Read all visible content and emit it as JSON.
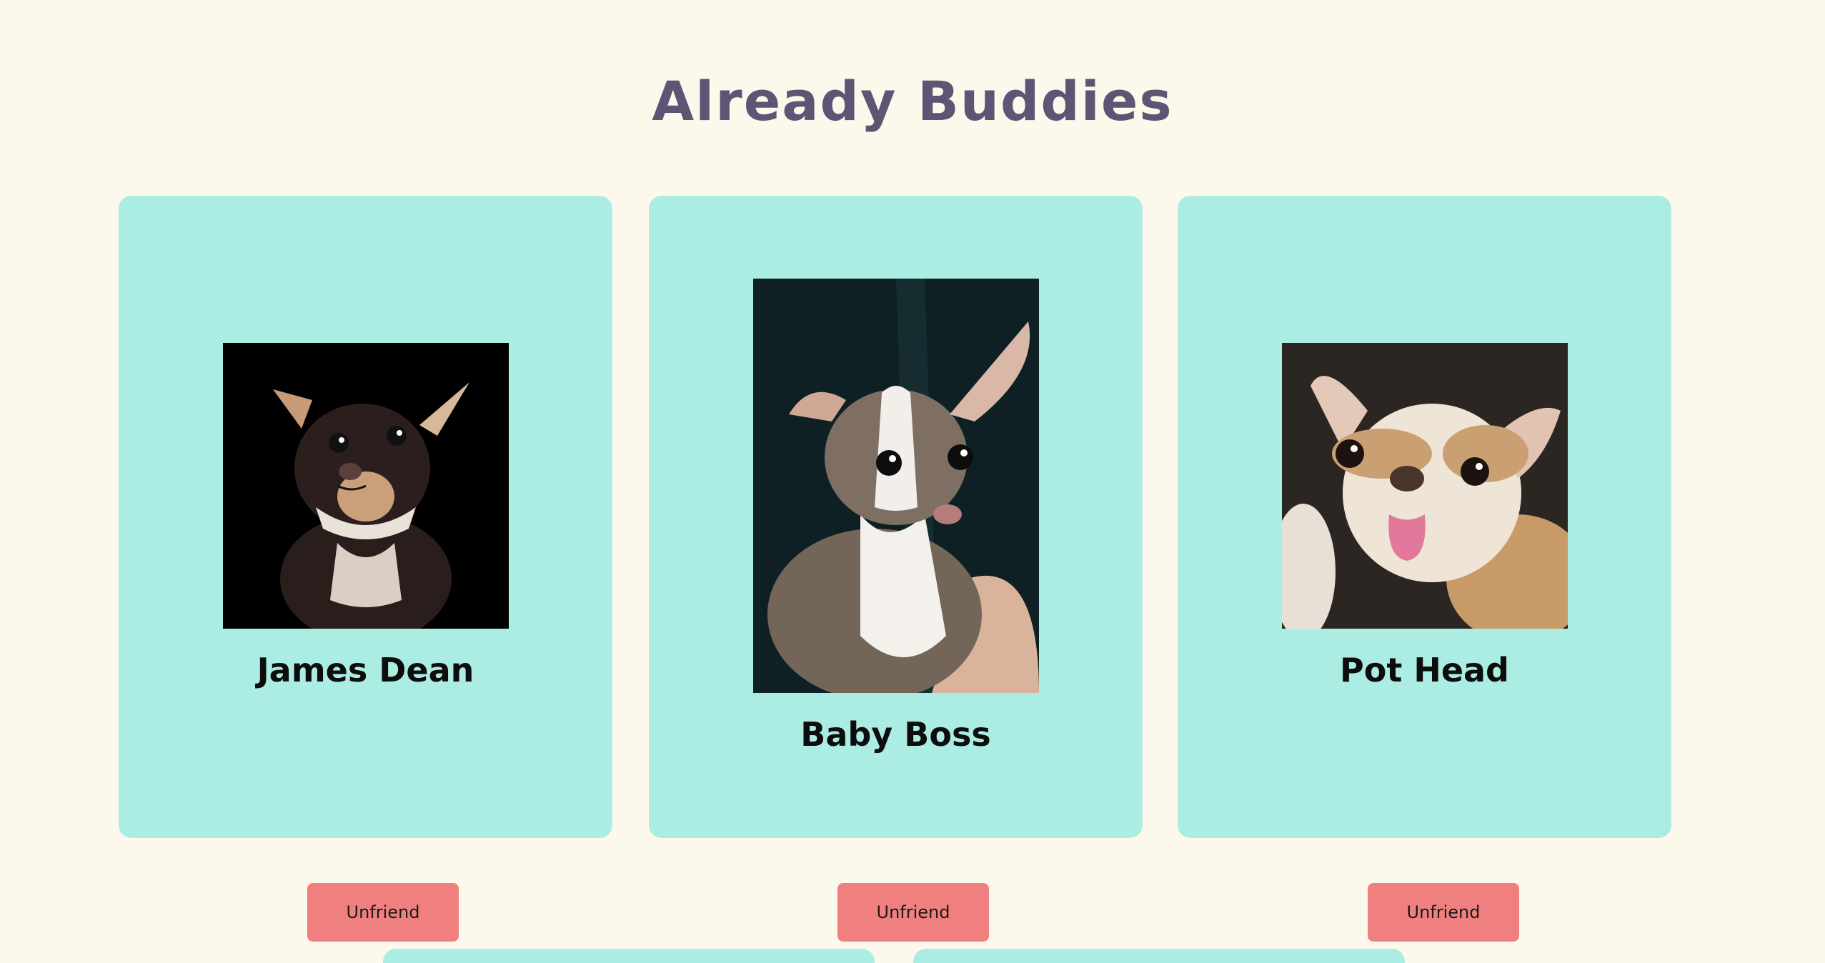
{
  "page": {
    "title": "Already Buddies"
  },
  "buddies": [
    {
      "name": "James Dean",
      "photo": "chihuahua-dark-photo",
      "unfriend_label": "Unfriend"
    },
    {
      "name": "Baby Boss",
      "photo": "chihuahua-puppy-photo",
      "unfriend_label": "Unfriend"
    },
    {
      "name": "Pot Head",
      "photo": "chihuahua-tongue-photo",
      "unfriend_label": "Unfriend"
    }
  ],
  "colors": {
    "background": "#fdf8ec",
    "title": "#5f5474",
    "card": "#acede3",
    "button": "#f08080"
  }
}
